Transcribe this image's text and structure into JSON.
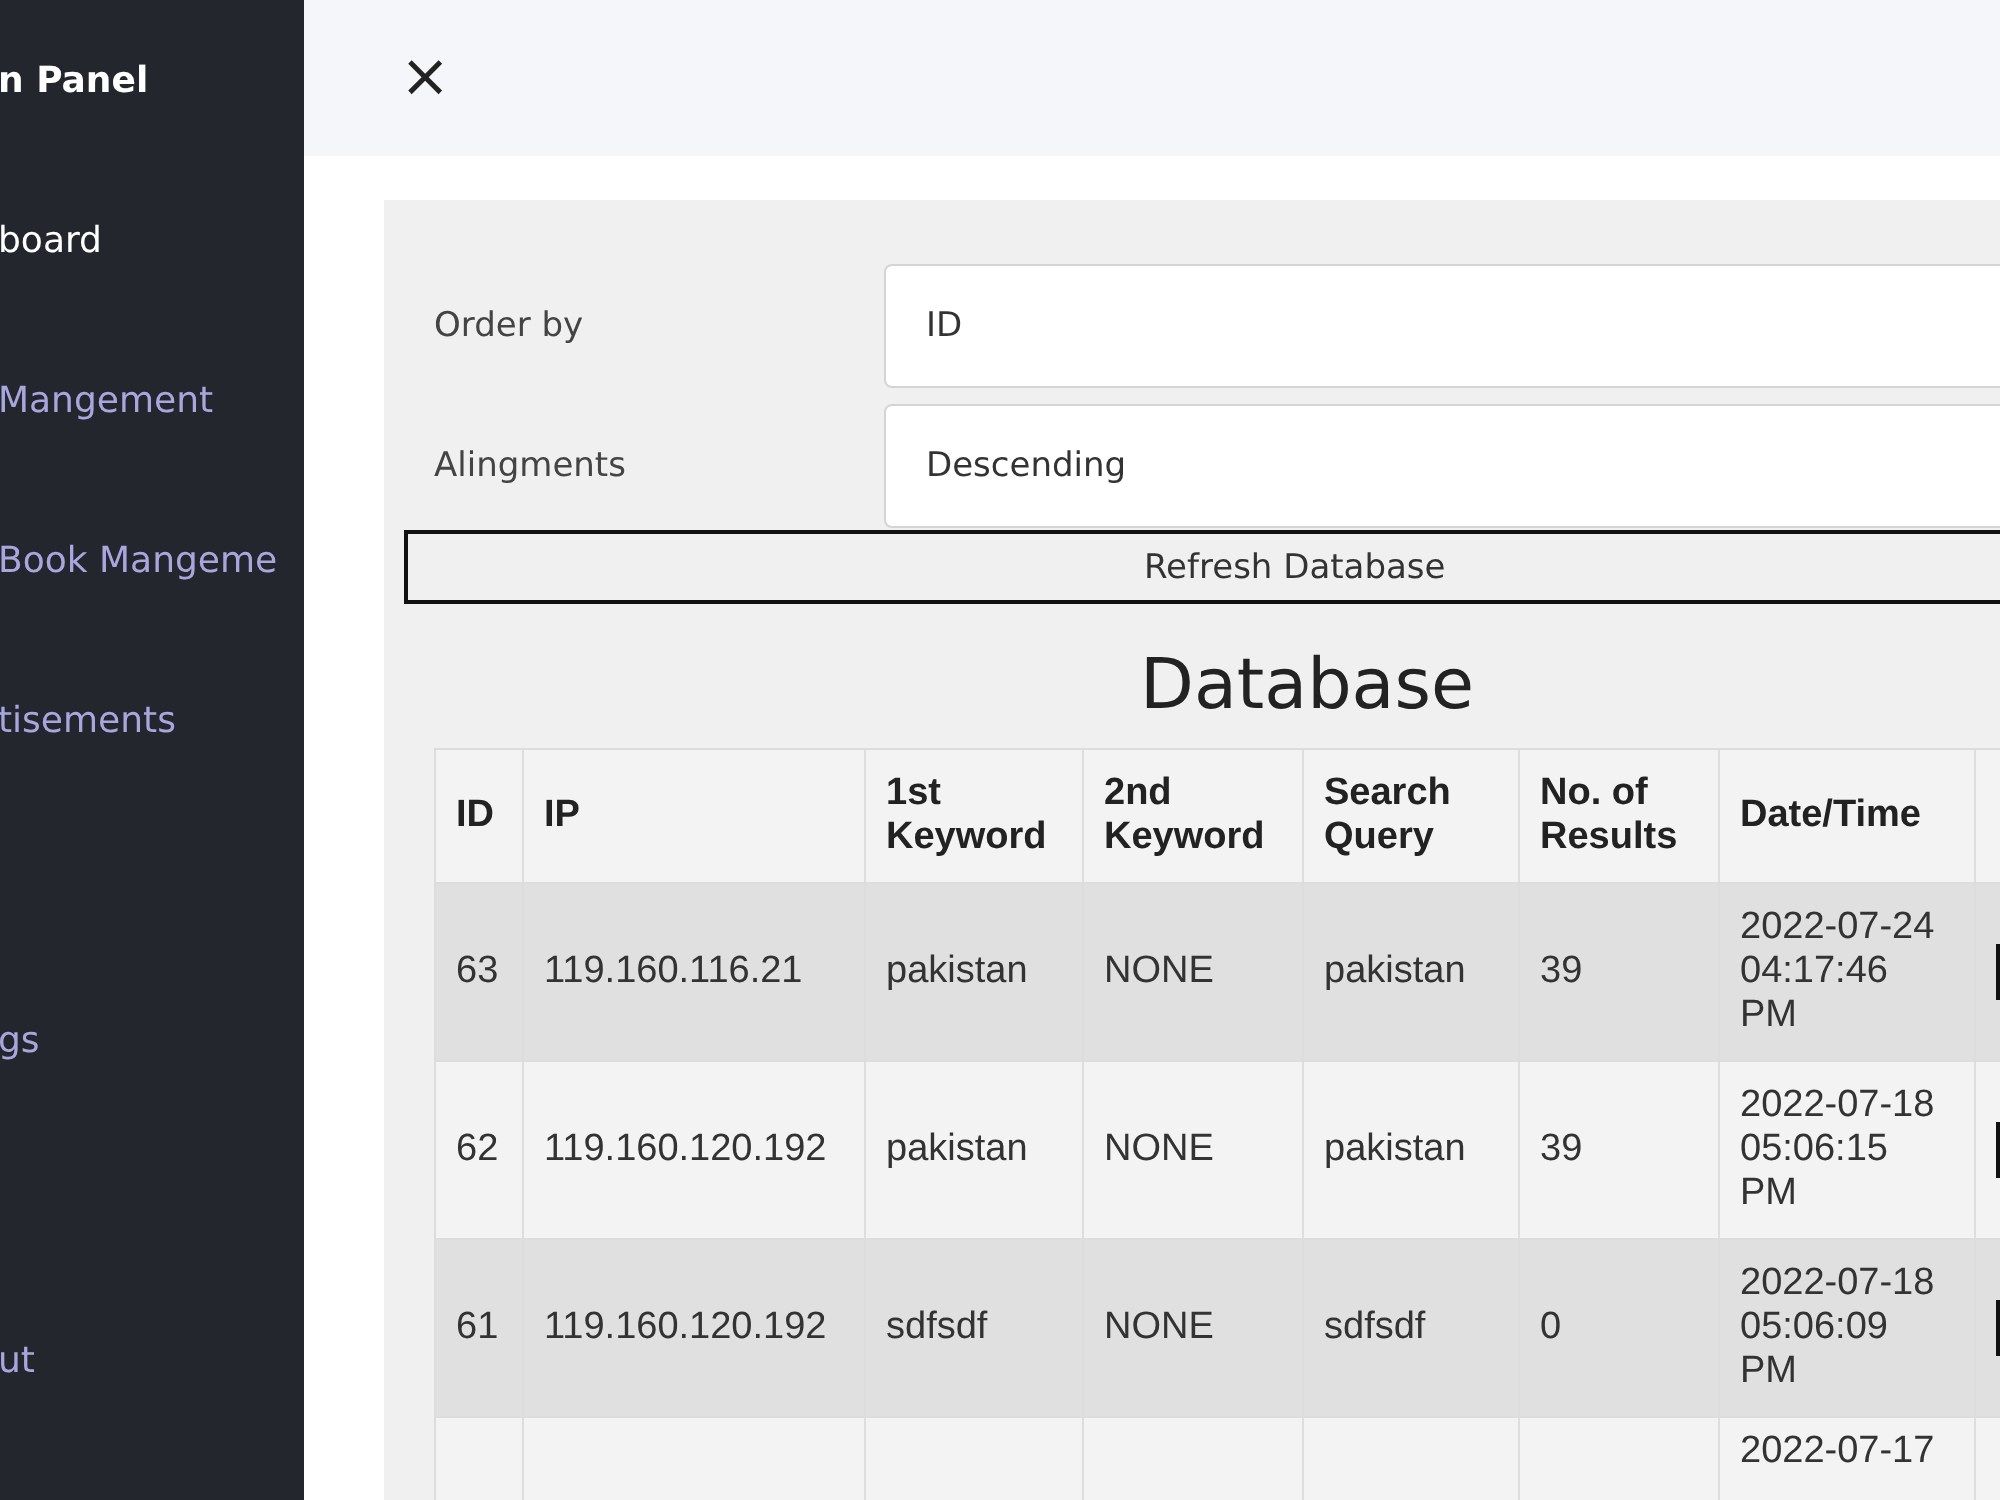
{
  "sidebar": {
    "title": "n Panel",
    "items": [
      {
        "label": "board",
        "selected": true
      },
      {
        "label": "Mangement",
        "selected": false
      },
      {
        "label": "Book Mangeme",
        "selected": false
      },
      {
        "label": "tisements",
        "selected": false
      },
      {
        "label": "gs",
        "selected": false
      },
      {
        "label": "ut",
        "selected": false
      }
    ]
  },
  "topbar": {
    "close": "×"
  },
  "form": {
    "fields": [
      {
        "label": "Order by",
        "value": "ID"
      },
      {
        "label": "Alingments",
        "value": "Descending"
      }
    ],
    "refresh_button": "Refresh Database"
  },
  "table": {
    "title": "Database",
    "columns": [
      "ID",
      "IP",
      "1st Keyword",
      "2nd Keyword",
      "Search Query",
      "No. of Results",
      "Date/Time"
    ],
    "rows": [
      {
        "cells": [
          "63",
          "119.160.116.21",
          "pakistan",
          "NONE",
          "pakistan",
          "39",
          "2022-07-24 04:17:46 PM"
        ]
      },
      {
        "cells": [
          "62",
          "119.160.120.192",
          "pakistan",
          "NONE",
          "pakistan",
          "39",
          "2022-07-18 05:06:15 PM"
        ]
      },
      {
        "cells": [
          "61",
          "119.160.120.192",
          "sdfsdf",
          "NONE",
          "sdfsdf",
          "0",
          "2022-07-18 05:06:09 PM"
        ]
      },
      {
        "cells": [
          null,
          null,
          null,
          null,
          null,
          null,
          "2022-07-17"
        ]
      }
    ]
  }
}
